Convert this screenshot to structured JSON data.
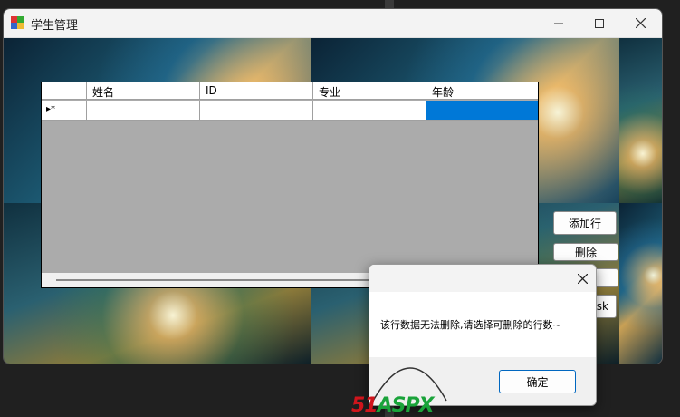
{
  "window": {
    "title": "学生管理"
  },
  "grid": {
    "columns": [
      "姓名",
      "ID",
      "专业",
      "年龄"
    ],
    "new_row_marker": "▸*"
  },
  "buttons": {
    "add_row": "添加行",
    "delete": "删除",
    "hidden_button": "",
    "partial_label": "sk"
  },
  "dialog": {
    "message": "该行数据无法删除,请选择可删除的行数~",
    "ok_label": "确定"
  },
  "watermark": {
    "logo_text": "51ASPX"
  },
  "colors": {
    "selection": "#0078d7",
    "grid_background": "#ababab",
    "accent": "#0067c0"
  }
}
